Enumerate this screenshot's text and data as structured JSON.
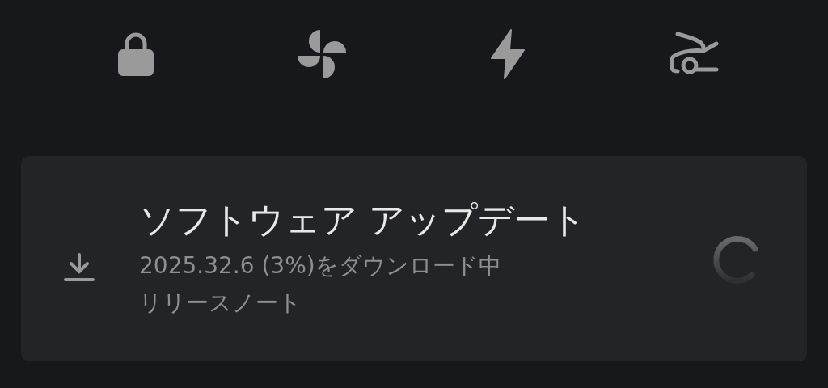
{
  "quick_controls": [
    {
      "kind": "lock"
    },
    {
      "kind": "fan"
    },
    {
      "kind": "bolt"
    },
    {
      "kind": "trunk"
    }
  ],
  "update_card": {
    "title": "ソフトウェア アップデート",
    "status": "2025.32.6 (3%)をダウンロード中",
    "link": "リリースノート"
  }
}
